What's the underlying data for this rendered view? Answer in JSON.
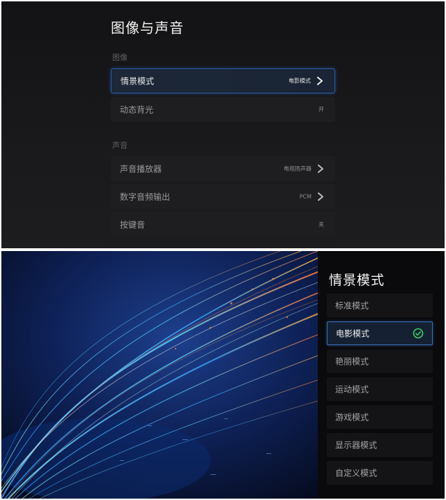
{
  "settings": {
    "title": "图像与声音",
    "picture_section": {
      "label": "图像",
      "items": [
        {
          "label": "情景模式",
          "value": "电影模式",
          "has_chevron": true,
          "selected": true
        },
        {
          "label": "动态背光",
          "value": "开",
          "has_chevron": false,
          "selected": false
        }
      ]
    },
    "sound_section": {
      "label": "声音",
      "items": [
        {
          "label": "声音播放器",
          "value": "电视扬声器",
          "has_chevron": true,
          "selected": false
        },
        {
          "label": "数字音频输出",
          "value": "PCM",
          "has_chevron": true,
          "selected": false
        },
        {
          "label": "按键音",
          "value": "关",
          "has_chevron": false,
          "selected": false
        }
      ]
    }
  },
  "mode_panel": {
    "title": "情景模式",
    "options": [
      {
        "label": "标准模式",
        "selected": false
      },
      {
        "label": "电影模式",
        "selected": true
      },
      {
        "label": "艳丽模式",
        "selected": false
      },
      {
        "label": "运动模式",
        "selected": false
      },
      {
        "label": "游戏模式",
        "selected": false
      },
      {
        "label": "显示器模式",
        "selected": false
      },
      {
        "label": "自定义模式",
        "selected": false
      }
    ]
  },
  "icons": {
    "chevron": "chevron-right-icon",
    "selected_check": "check-circle-icon"
  },
  "colors": {
    "selection_border": "#2f5ea3",
    "check_green": "#3fcf6a",
    "background_dark": "#131315"
  }
}
